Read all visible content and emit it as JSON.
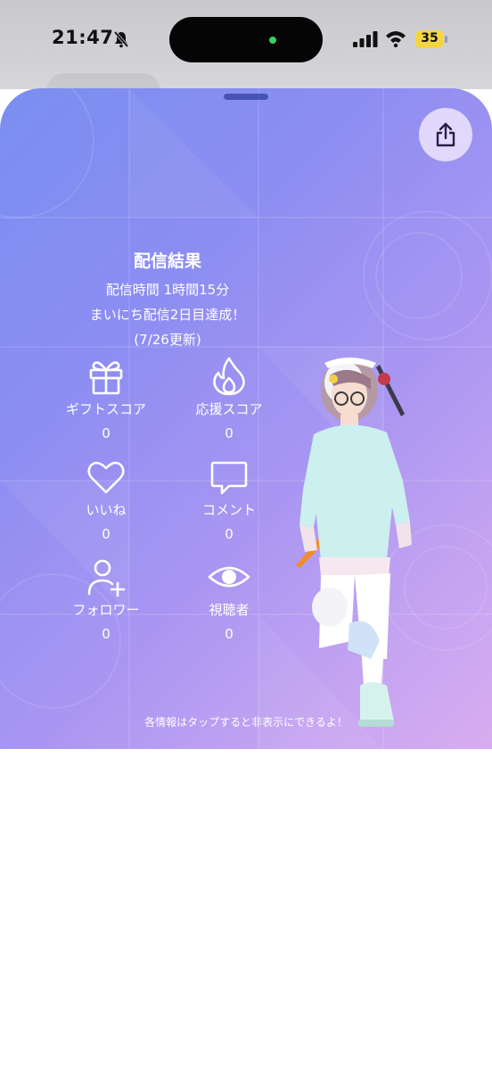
{
  "status_bar": {
    "time": "21:47",
    "battery": "35"
  },
  "result": {
    "title": "配信結果",
    "duration": "配信時間 1時間15分",
    "streak": "まいにち配信2日目達成！",
    "updated": "(7/26更新)"
  },
  "stats": [
    {
      "label": "ギフトスコア",
      "value": "0",
      "icon": "gift-icon"
    },
    {
      "label": "応援スコア",
      "value": "0",
      "icon": "flame-icon"
    },
    {
      "label": "いいね",
      "value": "0",
      "icon": "heart-icon"
    },
    {
      "label": "コメント",
      "value": "0",
      "icon": "comment-icon"
    },
    {
      "label": "フォロワー",
      "value": "0",
      "icon": "add-user-icon"
    },
    {
      "label": "視聴者",
      "value": "0",
      "icon": "eye-icon"
    }
  ],
  "hint": "各情報はタップすると非表示にできるよ！",
  "colors": {
    "sheet_start": "#7a8ff0",
    "sheet_end": "#d8acf0",
    "share_button": "#e2d8fb",
    "handle": "#3c4aa8"
  }
}
